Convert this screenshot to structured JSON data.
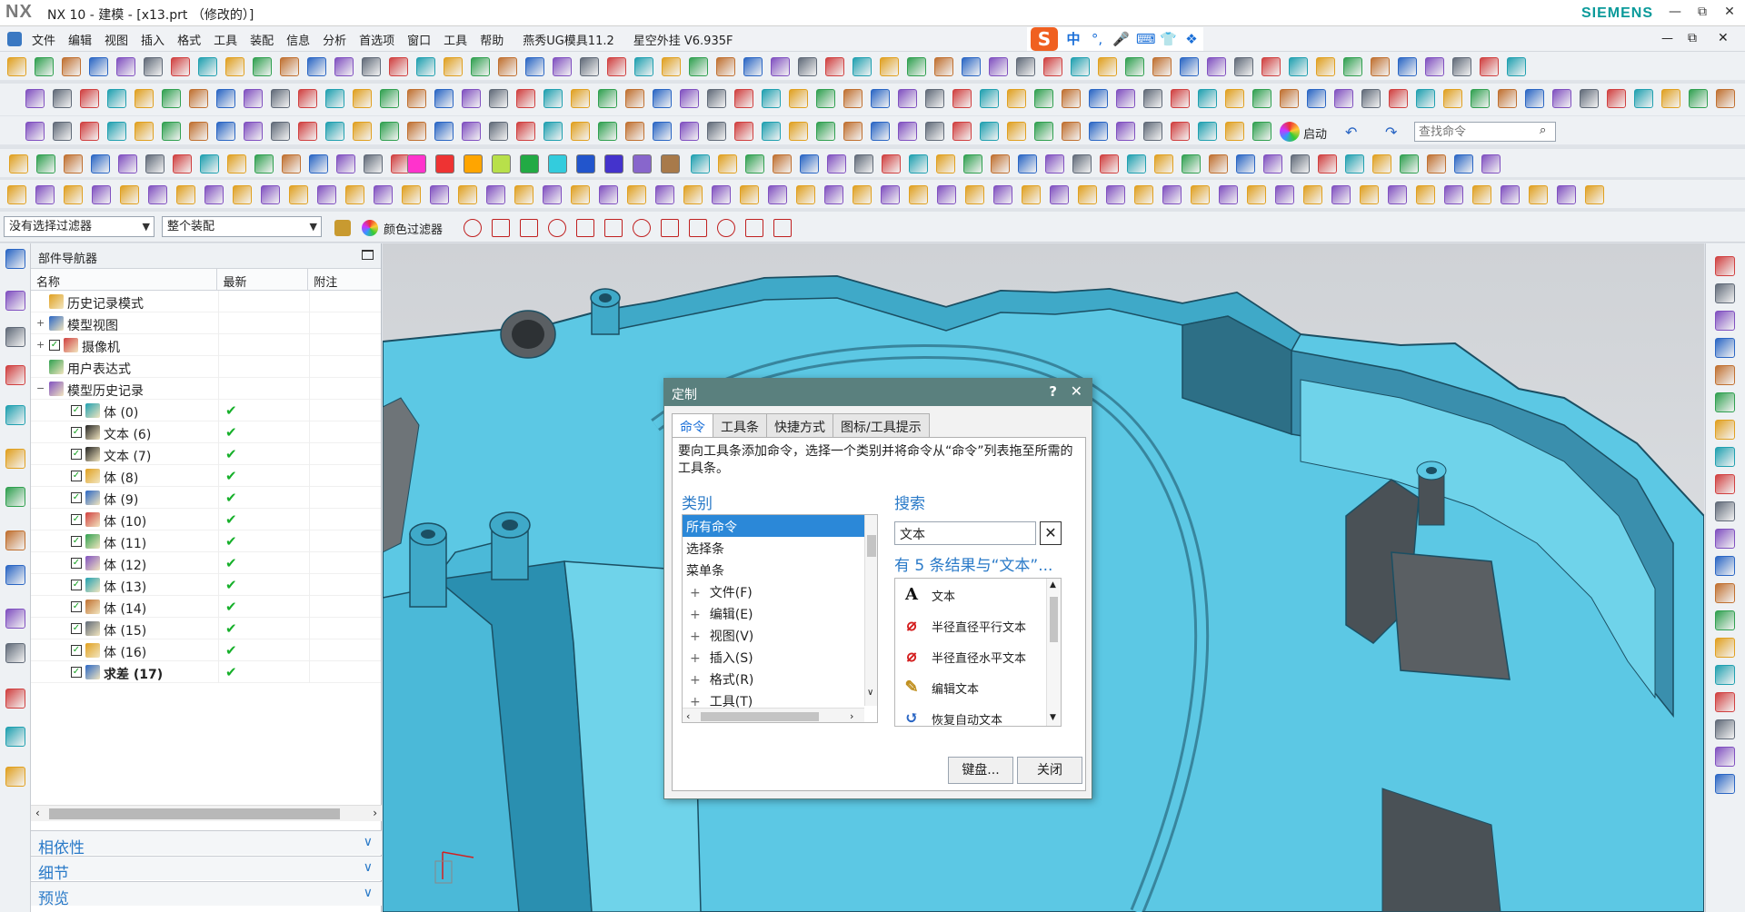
{
  "window": {
    "logo": "NX",
    "title": "NX 10 - 建模 - [x13.prt （修改的）]",
    "brand": "SIEMENS",
    "controls": [
      "—",
      "⧉",
      "✕"
    ]
  },
  "menubar": {
    "items": [
      "文件",
      "编辑",
      "视图",
      "插入",
      "格式",
      "工具",
      "装配",
      "信息",
      "分析",
      "首选项",
      "窗口",
      "工具",
      "帮助"
    ],
    "plugins": [
      "燕秀UG模具11.2",
      "星空外挂 V6.935F"
    ]
  },
  "ime": {
    "logo": "S",
    "lang": "中"
  },
  "toolbar": {
    "start_label": "启动",
    "find_command_placeholder": "查找命令",
    "color_swatches": [
      "#ff33cc",
      "#ee3333",
      "#ffa500",
      "#b8e04a",
      "#22aa44",
      "#33ccdd",
      "#2255cc",
      "#4433cc",
      "#8866cc",
      "#a87a4a"
    ]
  },
  "filterbar": {
    "selection_filter": "没有选择过滤器",
    "assembly_scope": "整个装配",
    "color_filter": "颜色过滤器"
  },
  "navigator": {
    "title": "部件导航器",
    "columns": [
      "名称",
      "最新",
      "附注"
    ],
    "rows": [
      {
        "label": "历史记录模式",
        "indent": 0,
        "expander": "",
        "checked": false,
        "latest": false,
        "bold": false
      },
      {
        "label": "模型视图",
        "indent": 0,
        "expander": "+",
        "checked": false,
        "latest": false,
        "bold": false
      },
      {
        "label": "摄像机",
        "indent": 0,
        "expander": "+",
        "checked": true,
        "latest": false,
        "bold": false
      },
      {
        "label": "用户表达式",
        "indent": 0,
        "expander": "",
        "checked": false,
        "latest": false,
        "bold": false
      },
      {
        "label": "模型历史记录",
        "indent": 0,
        "expander": "−",
        "checked": false,
        "latest": false,
        "bold": false
      },
      {
        "label": "体 (0)",
        "indent": 1,
        "expander": "",
        "checked": true,
        "latest": true,
        "bold": false
      },
      {
        "label": "文本 (6)",
        "indent": 1,
        "expander": "",
        "checked": true,
        "latest": true,
        "bold": false
      },
      {
        "label": "文本 (7)",
        "indent": 1,
        "expander": "",
        "checked": true,
        "latest": true,
        "bold": false
      },
      {
        "label": "体 (8)",
        "indent": 1,
        "expander": "",
        "checked": true,
        "latest": true,
        "bold": false
      },
      {
        "label": "体 (9)",
        "indent": 1,
        "expander": "",
        "checked": true,
        "latest": true,
        "bold": false
      },
      {
        "label": "体 (10)",
        "indent": 1,
        "expander": "",
        "checked": true,
        "latest": true,
        "bold": false
      },
      {
        "label": "体 (11)",
        "indent": 1,
        "expander": "",
        "checked": true,
        "latest": true,
        "bold": false
      },
      {
        "label": "体 (12)",
        "indent": 1,
        "expander": "",
        "checked": true,
        "latest": true,
        "bold": false
      },
      {
        "label": "体 (13)",
        "indent": 1,
        "expander": "",
        "checked": true,
        "latest": true,
        "bold": false
      },
      {
        "label": "体 (14)",
        "indent": 1,
        "expander": "",
        "checked": true,
        "latest": true,
        "bold": false
      },
      {
        "label": "体 (15)",
        "indent": 1,
        "expander": "",
        "checked": true,
        "latest": true,
        "bold": false
      },
      {
        "label": "体 (16)",
        "indent": 1,
        "expander": "",
        "checked": true,
        "latest": true,
        "bold": false
      },
      {
        "label": "求差 (17)",
        "indent": 1,
        "expander": "",
        "checked": true,
        "latest": true,
        "bold": true
      }
    ],
    "latest_mark": "✔",
    "sections": [
      "相依性",
      "细节",
      "预览"
    ]
  },
  "dialog": {
    "title": "定制",
    "help": "?",
    "close": "✕",
    "tabs": [
      "命令",
      "工具条",
      "快捷方式",
      "图标/工具提示"
    ],
    "active_tab": 0,
    "description": "要向工具条添加命令，选择一个类别并将命令从“命令”列表拖至所需的工具条。",
    "category_title": "类别",
    "categories": [
      {
        "label": "所有命令",
        "plus": false
      },
      {
        "label": "选择条",
        "plus": false
      },
      {
        "label": "菜单条",
        "plus": false
      },
      {
        "label": "文件(F)",
        "plus": true
      },
      {
        "label": "编辑(E)",
        "plus": true
      },
      {
        "label": "视图(V)",
        "plus": true
      },
      {
        "label": "插入(S)",
        "plus": true
      },
      {
        "label": "格式(R)",
        "plus": true
      },
      {
        "label": "工具(T)",
        "plus": true
      }
    ],
    "selected_category": 0,
    "search_title": "搜索",
    "search_value": "文本",
    "result_title": "有 5 条结果与“文本”...",
    "results": [
      {
        "label": "文本",
        "icon": "text-A-icon"
      },
      {
        "label": "半径直径平行文本",
        "icon": "radius-parallel-text-icon"
      },
      {
        "label": "半径直径水平文本",
        "icon": "radius-horizontal-text-icon"
      },
      {
        "label": "编辑文本",
        "icon": "edit-text-icon"
      },
      {
        "label": "恢复自动文本",
        "icon": "restore-auto-text-icon"
      }
    ],
    "keyboard_btn": "键盘...",
    "close_btn": "关闭"
  },
  "viewport": {
    "colors": {
      "part": "#5cc8e4",
      "part_dark": "#2a8fb0",
      "edge": "#1b4f63",
      "gray": "#5a5f63"
    }
  }
}
